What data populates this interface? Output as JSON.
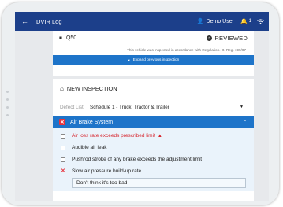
{
  "topbar": {
    "title": "DVIR Log",
    "user": "Demo User",
    "notification_count": "1"
  },
  "vehicle": {
    "unit": "Q50",
    "status": "REVIEWED",
    "regulation_note": "This vehicle was inspected in accordance with Regulation. O. Reg. 199/07",
    "expand_label": "Expand previous inspection"
  },
  "inspection": {
    "title": "NEW INSPECTION",
    "defect_list_label": "Defect List",
    "defect_list_value": "Schedule 1 - Truck, Tractor & Trailer",
    "system": {
      "name": "Air Brake System",
      "items": [
        {
          "label": "Air loss rate exceeds prescribed limit",
          "state": "major-defect"
        },
        {
          "label": "Audible air leak",
          "state": "unchecked"
        },
        {
          "label": "Pushrod stroke of any brake exceeds the adjustment limit",
          "state": "unchecked"
        },
        {
          "label": "Slow air pressure build-up rate",
          "state": "defect"
        }
      ],
      "comment": "Don't think it's too bad"
    }
  },
  "colors": {
    "topbar": "#1c3f8a",
    "accent": "#1e74c9",
    "defect_red": "#e8323c"
  }
}
